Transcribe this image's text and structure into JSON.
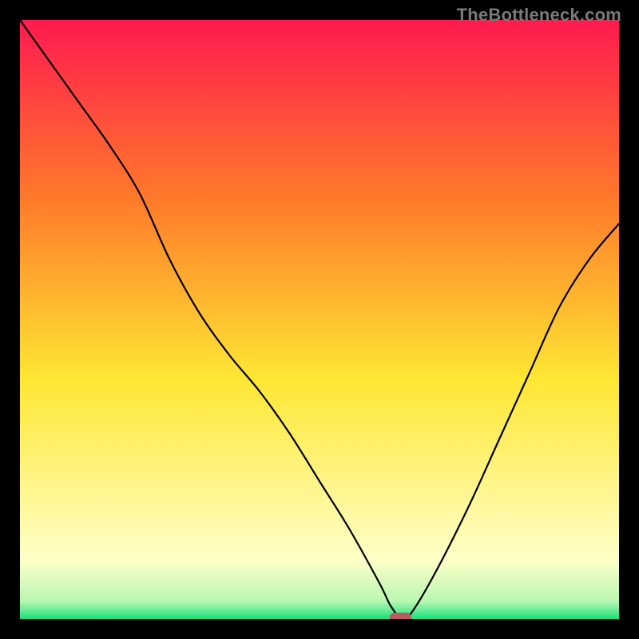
{
  "watermark": "TheBottleneck.com",
  "colors": {
    "gradient_top": "#ff1a50",
    "gradient_mid1": "#ff7a2a",
    "gradient_mid2": "#ffe733",
    "gradient_pale": "#ffffc8",
    "gradient_bottom": "#18e07a",
    "curve": "#000000",
    "marker": "#bb5a60",
    "frame": "#000000"
  },
  "chart_data": {
    "type": "line",
    "title": "",
    "xlabel": "",
    "ylabel": "",
    "xlim": [
      0,
      100
    ],
    "ylim": [
      0,
      100
    ],
    "series": [
      {
        "name": "bottleneck-curve",
        "x": [
          0,
          5,
          10,
          15,
          20,
          25,
          30,
          35,
          40,
          45,
          50,
          55,
          60,
          62,
          64,
          66,
          70,
          75,
          80,
          85,
          90,
          95,
          100
        ],
        "values": [
          100,
          93,
          86,
          79,
          71,
          60,
          51,
          44,
          38,
          31,
          23,
          15,
          6,
          2,
          0,
          2,
          9,
          19,
          30,
          41,
          52,
          60,
          66
        ]
      }
    ],
    "marker": {
      "x": 63.5,
      "y": 0,
      "w": 3.6,
      "h": 1.6
    },
    "gradient_stops": [
      {
        "offset": 0.0,
        "color": "#ff1a50"
      },
      {
        "offset": 0.3,
        "color": "#ff7a2a"
      },
      {
        "offset": 0.6,
        "color": "#ffe733"
      },
      {
        "offset": 0.9,
        "color": "#ffffc8"
      },
      {
        "offset": 0.97,
        "color": "#b9f7b2"
      },
      {
        "offset": 1.0,
        "color": "#18e07a"
      }
    ]
  }
}
